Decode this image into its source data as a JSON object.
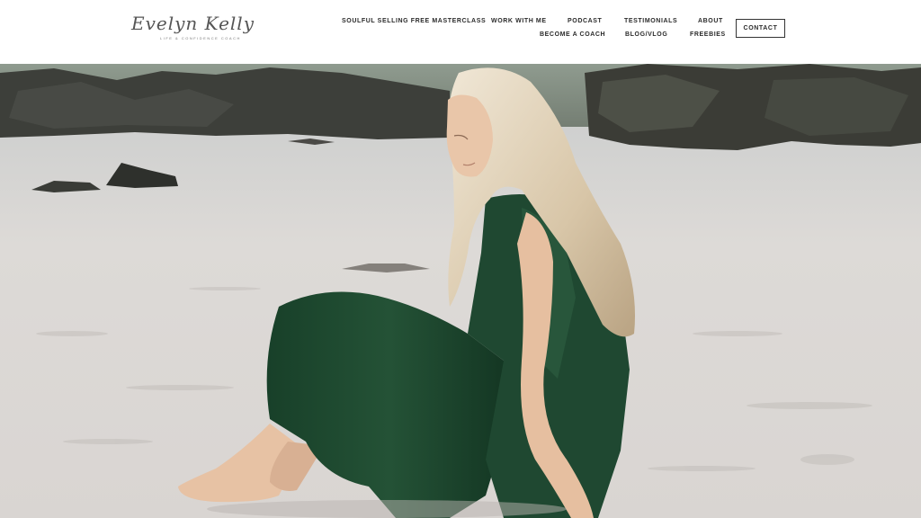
{
  "brand": {
    "script_name": "Evelyn Kelly",
    "tagline": "LIFE & CONFIDENCE COACH"
  },
  "nav": {
    "masterclass": "SOULFUL SELLING FREE MASTERCLASS",
    "work_with_me": "WORK WITH ME",
    "podcast": "PODCAST",
    "testimonials": "TESTIMONIALS",
    "about": "ABOUT",
    "become_a_coach": "BECOME A COACH",
    "blog_vlog": "BLOG/VLOG",
    "freebies": "FREEBIES",
    "contact": "CONTACT"
  },
  "hero": {
    "image": "woman-in-green-dress-on-beach",
    "colors": {
      "sand": "#dedbd8",
      "rock": "#3d3f3a",
      "dress": "#1f4630",
      "hair": "#e2d5c0"
    }
  }
}
